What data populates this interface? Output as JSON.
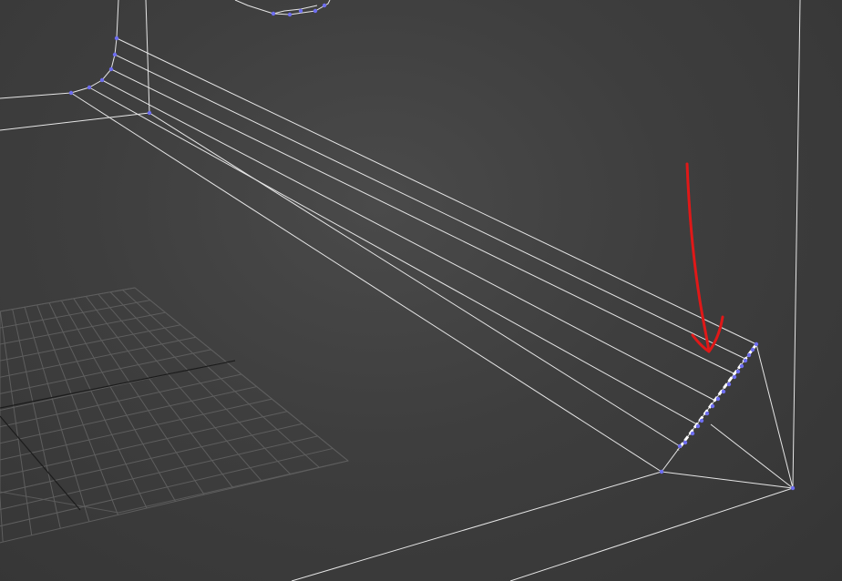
{
  "app": {
    "view": "perspective-viewport",
    "mode": "wireframe"
  },
  "colors": {
    "background": "#3e3e3e",
    "grid_line": "#5e5e5e",
    "grid_axis": "#1e1e1e",
    "wire": "#e8e8e8",
    "vertex": "#6e6ef0",
    "selection_edge": "#ffffff",
    "annotation_arrow": "#e01818"
  },
  "icons": {
    "annotation": "arrow-down-icon"
  }
}
